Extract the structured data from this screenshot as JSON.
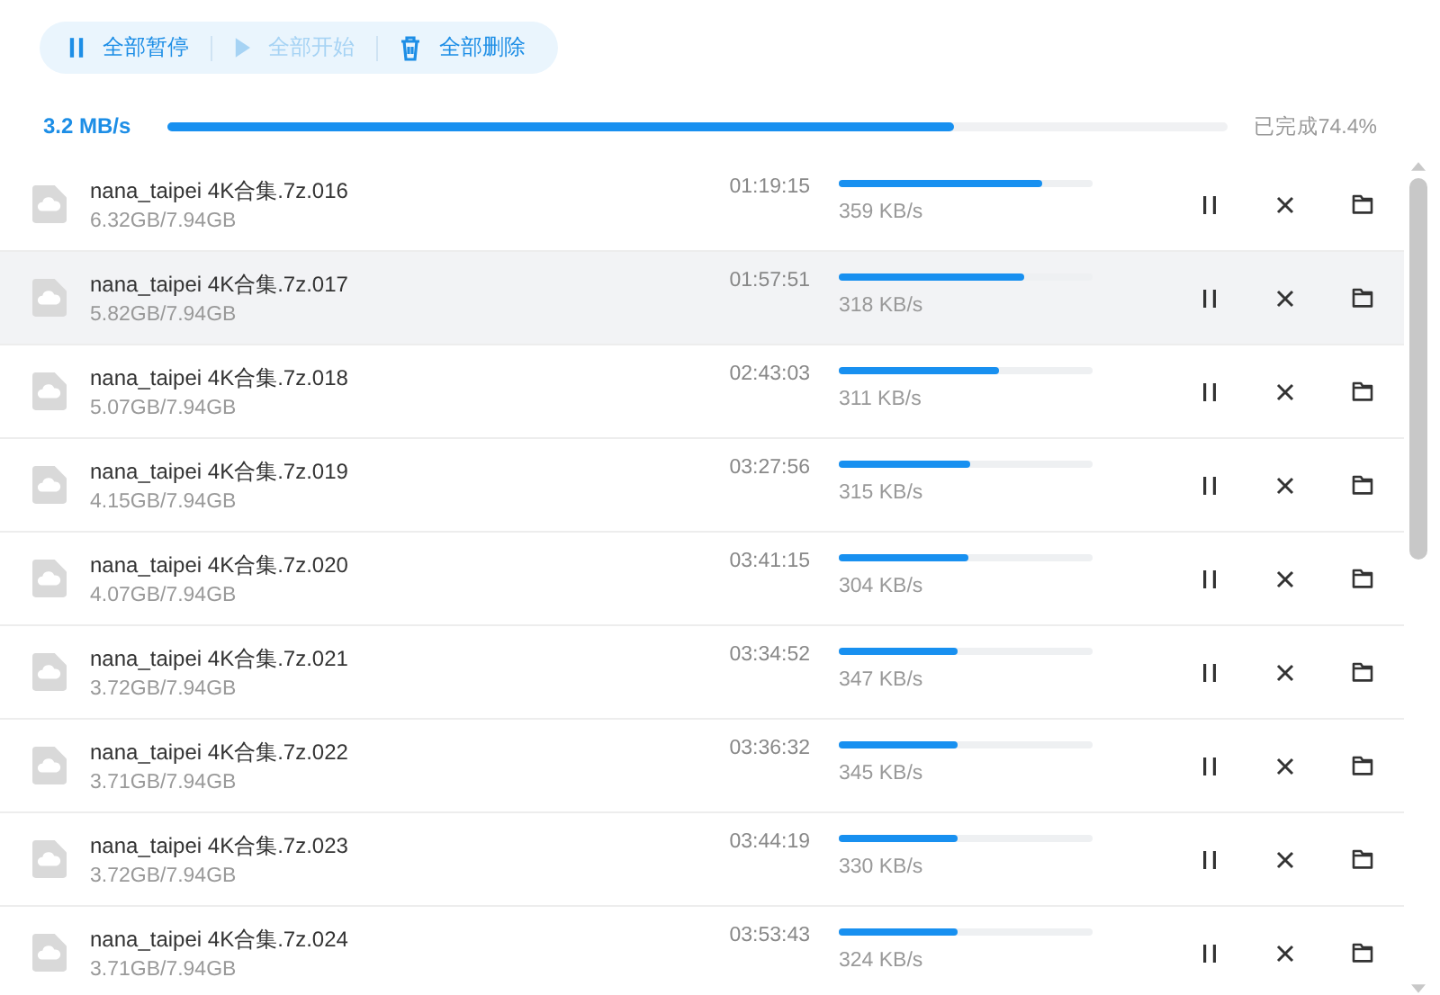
{
  "toolbar": [
    {
      "kind": "pause",
      "label": "全部暂停",
      "disabled": false
    },
    {
      "kind": "start",
      "label": "全部开始",
      "disabled": true
    },
    {
      "kind": "delete",
      "label": "全部删除",
      "disabled": false
    }
  ],
  "overall": {
    "speed": "3.2 MB/s",
    "level": 0.742,
    "status": "已完成74.4%"
  },
  "downloads": [
    {
      "name": "nana_taipei 4K合集.7z.016",
      "size": "6.32GB/7.94GB",
      "time": "01:19:15",
      "level": 0.8,
      "speed": "359 KB/s",
      "selected": false
    },
    {
      "name": "nana_taipei 4K合集.7z.017",
      "size": "5.82GB/7.94GB",
      "time": "01:57:51",
      "level": 0.73,
      "speed": "318 KB/s",
      "selected": true
    },
    {
      "name": "nana_taipei 4K合集.7z.018",
      "size": "5.07GB/7.94GB",
      "time": "02:43:03",
      "level": 0.63,
      "speed": "311 KB/s",
      "selected": false
    },
    {
      "name": "nana_taipei 4K合集.7z.019",
      "size": "4.15GB/7.94GB",
      "time": "03:27:56",
      "level": 0.52,
      "speed": "315 KB/s",
      "selected": false
    },
    {
      "name": "nana_taipei 4K合集.7z.020",
      "size": "4.07GB/7.94GB",
      "time": "03:41:15",
      "level": 0.51,
      "speed": "304 KB/s",
      "selected": false
    },
    {
      "name": "nana_taipei 4K合集.7z.021",
      "size": "3.72GB/7.94GB",
      "time": "03:34:52",
      "level": 0.47,
      "speed": "347 KB/s",
      "selected": false
    },
    {
      "name": "nana_taipei 4K合集.7z.022",
      "size": "3.71GB/7.94GB",
      "time": "03:36:32",
      "level": 0.47,
      "speed": "345 KB/s",
      "selected": false
    },
    {
      "name": "nana_taipei 4K合集.7z.023",
      "size": "3.72GB/7.94GB",
      "time": "03:44:19",
      "level": 0.47,
      "speed": "330 KB/s",
      "selected": false
    },
    {
      "name": "nana_taipei 4K合集.7z.024",
      "size": "3.71GB/7.94GB",
      "time": "03:53:43",
      "level": 0.47,
      "speed": "324 KB/s",
      "selected": false
    }
  ]
}
